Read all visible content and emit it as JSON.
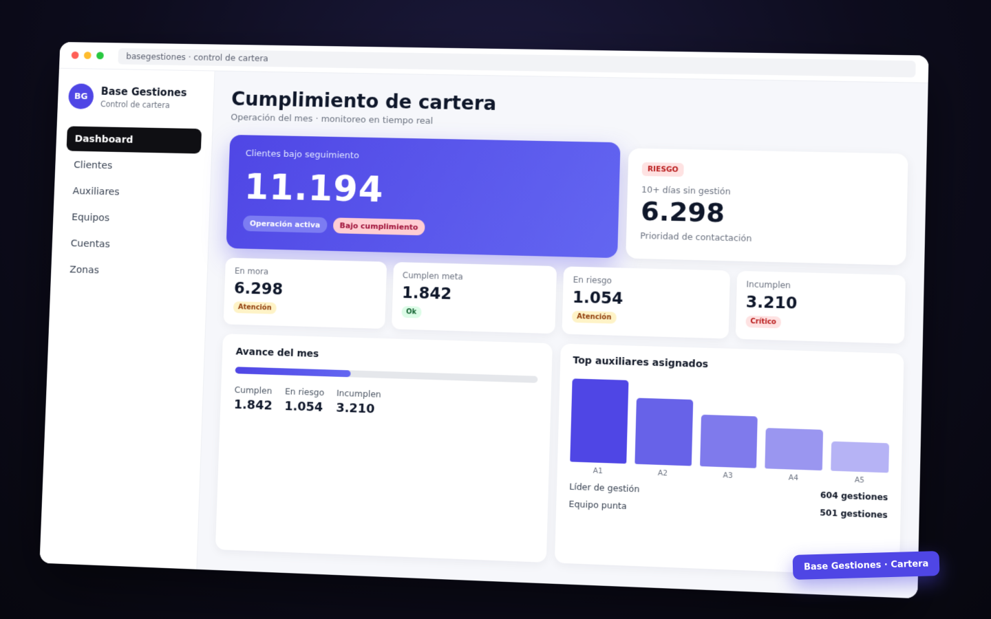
{
  "window": {
    "url": "basegestiones · control de cartera"
  },
  "brand": {
    "initials": "BG",
    "name": "Base Gestiones",
    "subtitle": "Control de cartera"
  },
  "nav": {
    "items": [
      {
        "label": "Dashboard",
        "active": true
      },
      {
        "label": "Clientes"
      },
      {
        "label": "Auxiliares"
      },
      {
        "label": "Equipos"
      },
      {
        "label": "Cuentas"
      },
      {
        "label": "Zonas"
      }
    ]
  },
  "header": {
    "title": "Cumplimiento de cartera",
    "subtitle": "Operación del mes · monitoreo en tiempo real"
  },
  "hero": {
    "label": "Clientes bajo seguimiento",
    "value": "11.194",
    "pill_active": "Operación activa",
    "pill_low": "Bajo cumplimiento"
  },
  "risk": {
    "badge": "RIESGO",
    "label": "10+ días sin gestión",
    "value": "6.298",
    "note": "Prioridad de contactación"
  },
  "stats": [
    {
      "label": "En mora",
      "value": "6.298",
      "badge": "Atención",
      "tone": "warn"
    },
    {
      "label": "Cumplen meta",
      "value": "1.842",
      "badge": "Ok",
      "tone": "ok"
    },
    {
      "label": "En riesgo",
      "value": "1.054",
      "badge": "Atención",
      "tone": "warn"
    },
    {
      "label": "Incumplen",
      "value": "3.210",
      "badge": "Crítico",
      "tone": "crit"
    }
  ],
  "progress": {
    "title": "Avance del mes",
    "fraction": 0.385,
    "items": [
      {
        "label": "Cumplen",
        "value": "1.842"
      },
      {
        "label": "En riesgo",
        "value": "1.054"
      },
      {
        "label": "Incumplen",
        "value": "3.210"
      }
    ]
  },
  "top": {
    "title": "Top auxiliares asignados",
    "bars": [
      {
        "label": "A1",
        "level": 1.0,
        "color": "#4f46e5"
      },
      {
        "label": "A2",
        "level": 0.79,
        "color": "#6762e8"
      },
      {
        "label": "A3",
        "level": 0.62,
        "color": "#7f7aec"
      },
      {
        "label": "A4",
        "level": 0.48,
        "color": "#9a96f0"
      },
      {
        "label": "A5",
        "level": 0.35,
        "color": "#b6b3f5"
      }
    ],
    "lead_label": "Líder de gestión",
    "lead_value": "604 gestiones",
    "team_label": "Equipo punta",
    "team_value": "501 gestiones"
  },
  "footer": {
    "label": "Base Gestiones · Cartera"
  }
}
